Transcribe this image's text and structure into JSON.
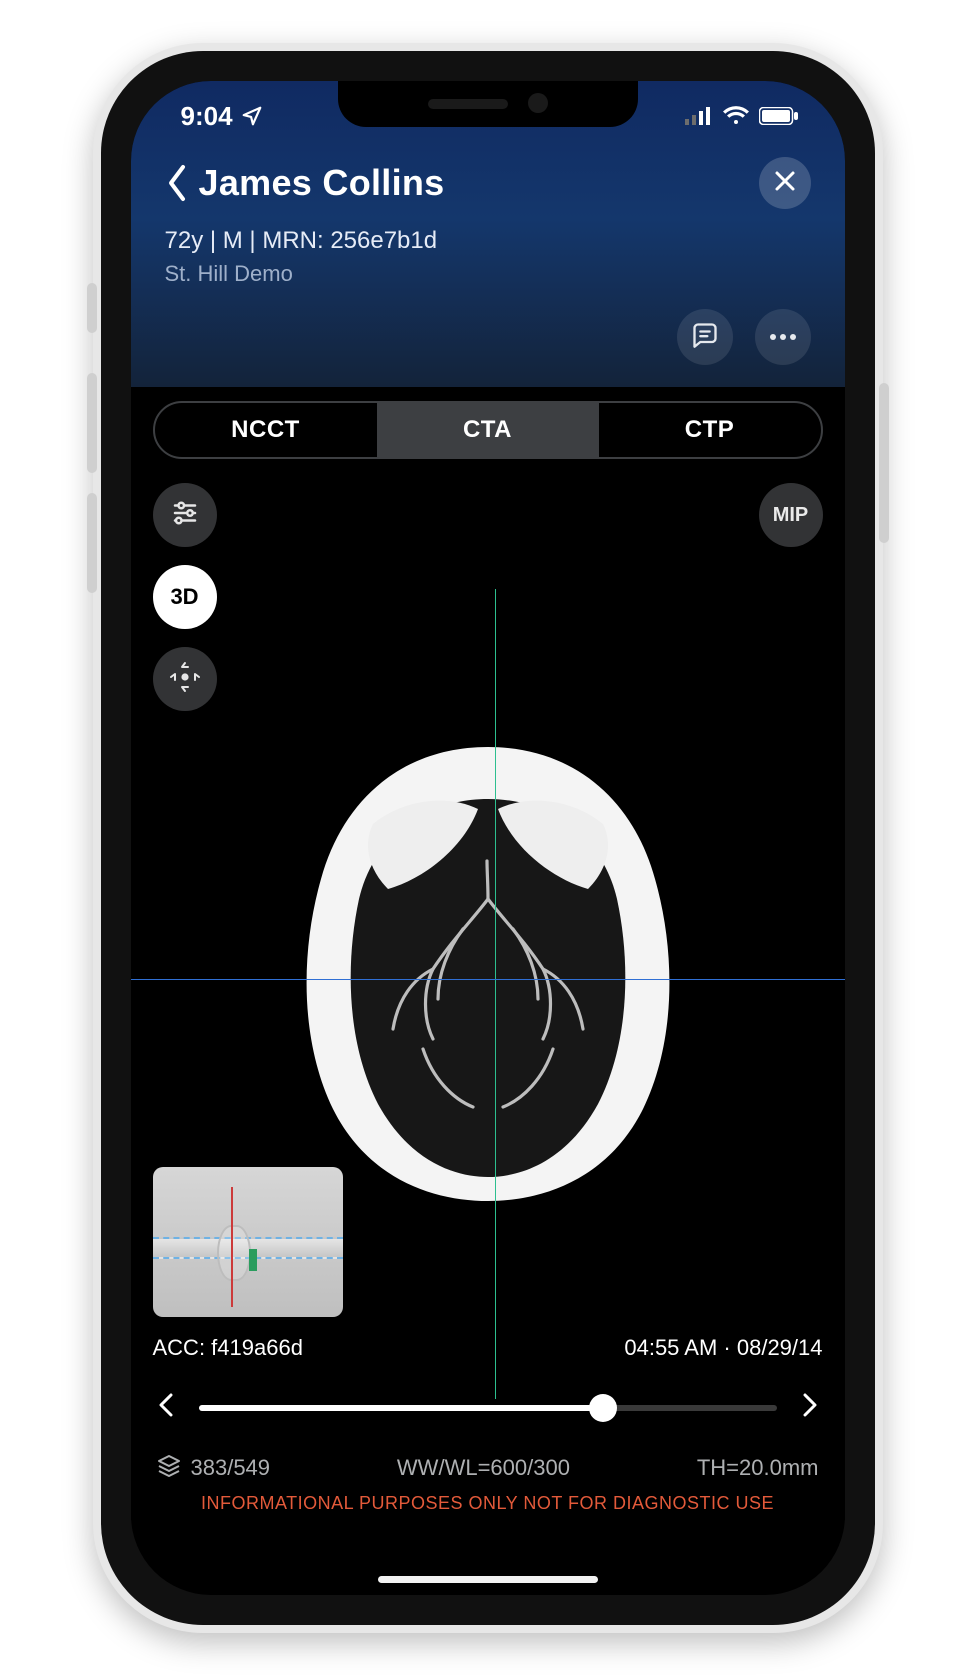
{
  "status": {
    "time": "9:04"
  },
  "header": {
    "patient_name": "James Collins",
    "subline": "72y  |  M  |  MRN: 256e7b1d",
    "facility": "St. Hill Demo"
  },
  "tabs": {
    "t1": "NCCT",
    "t2": "CTA",
    "t3": "CTP",
    "active": "CTA"
  },
  "tools": {
    "threeD": "3D",
    "mip": "MIP"
  },
  "meta": {
    "acc_label": "ACC: f419a66d",
    "datetime": "04:55 AM · 08/29/14"
  },
  "footer": {
    "slices": "383/549",
    "wwwl": "WW/WL=600/300",
    "thickness": "TH=20.0mm",
    "disclaimer": "INFORMATIONAL PURPOSES ONLY NOT FOR DIAGNOSTIC USE"
  }
}
